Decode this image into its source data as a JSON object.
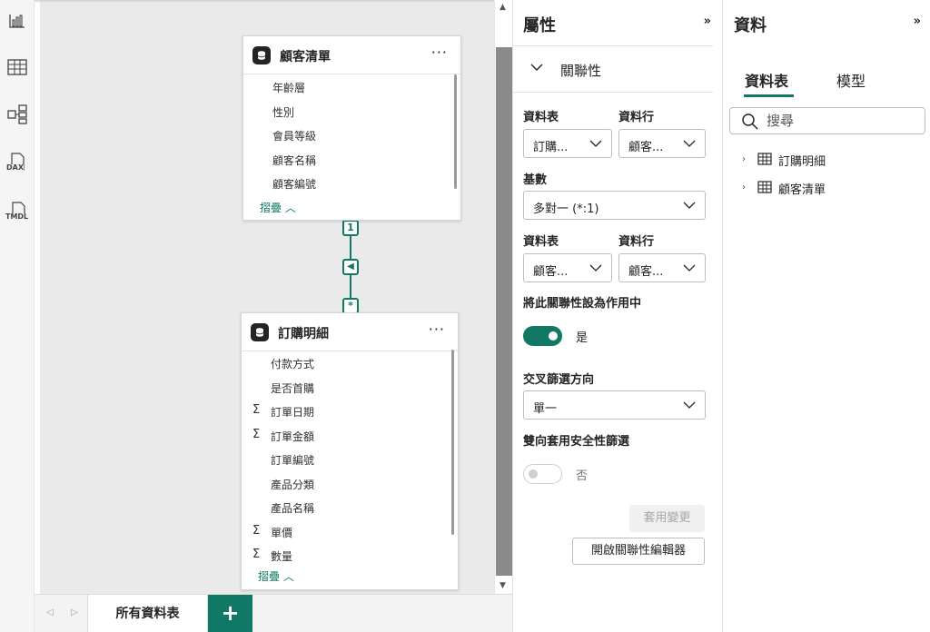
{
  "rail": {
    "icons": [
      "report-view-icon",
      "table-view-icon",
      "model-view-icon",
      "dax-query-icon",
      "tmdl-view-icon"
    ],
    "dax_label": "DAX",
    "tmdl_label": "TMDL"
  },
  "tables": {
    "customers": {
      "title": "顧客清單",
      "more": "···",
      "fields": [
        "年齡層",
        "性別",
        "會員等級",
        "顧客名稱",
        "顧客編號"
      ],
      "collapse": "摺疊 ︿"
    },
    "orders": {
      "title": "訂購明細",
      "more": "···",
      "fields": [
        {
          "name": "付款方式",
          "sum": ""
        },
        {
          "name": "是否首購",
          "sum": ""
        },
        {
          "name": "訂單日期",
          "sum": "Σ"
        },
        {
          "name": "訂單金額",
          "sum": "Σ"
        },
        {
          "name": "訂單編號",
          "sum": ""
        },
        {
          "name": "產品分類",
          "sum": ""
        },
        {
          "name": "產品名稱",
          "sum": ""
        },
        {
          "name": "單價",
          "sum": "Σ"
        },
        {
          "name": "數量",
          "sum": "Σ"
        }
      ],
      "collapse": "摺疊 ︿"
    }
  },
  "relationship": {
    "one_side": "1",
    "many_side": "*",
    "direction": "◀"
  },
  "bottom": {
    "tab_label": "所有資料表",
    "add_label": "+"
  },
  "properties": {
    "title": "屬性",
    "expand": "»",
    "section_title": "關聯性",
    "table_label_1": "資料表",
    "column_label_1": "資料行",
    "table_value_1": "訂購...",
    "column_value_1": "顧客...",
    "cardinality_label": "基數",
    "cardinality_value": "多對一 (*:1)",
    "table_label_2": "資料表",
    "column_label_2": "資料行",
    "table_value_2": "顧客...",
    "column_value_2": "顧客...",
    "active_label": "將此關聯性設為作用中",
    "active_value": "是",
    "crossfilter_label": "交叉篩選方向",
    "crossfilter_value": "單一",
    "security_label": "雙向套用安全性篩選",
    "security_value": "否",
    "apply_button": "套用變更",
    "editor_button": "開啟關聯性編輯器"
  },
  "data_pane": {
    "title": "資料",
    "expand": "»",
    "tab_tables": "資料表",
    "tab_model": "模型",
    "search_placeholder": "搜尋",
    "tree": [
      "訂購明細",
      "顧客清單"
    ]
  },
  "colors": {
    "accent": "#117865",
    "canvas": "#eaeaea"
  }
}
